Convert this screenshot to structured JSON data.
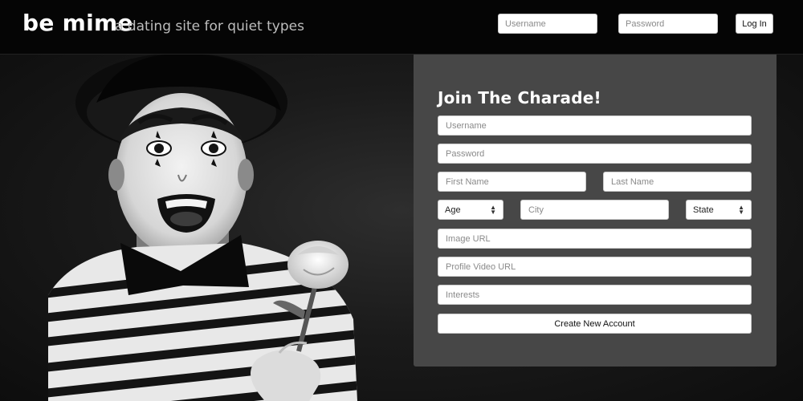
{
  "header": {
    "brand": "be mime",
    "tagline": "a dating site for quiet types",
    "username_placeholder": "Username",
    "password_placeholder": "Password",
    "login_label": "Log In"
  },
  "signup": {
    "title": "Join The Charade!",
    "username_placeholder": "Username",
    "password_placeholder": "Password",
    "first_name_placeholder": "First Name",
    "last_name_placeholder": "Last Name",
    "age_selected": "Age",
    "city_placeholder": "City",
    "state_selected": "State",
    "image_url_placeholder": "Image URL",
    "profile_video_placeholder": "Profile Video URL",
    "interests_placeholder": "Interests",
    "create_label": "Create New Account"
  },
  "icons": {
    "select_arrows": "up-down-chevron-icon"
  }
}
